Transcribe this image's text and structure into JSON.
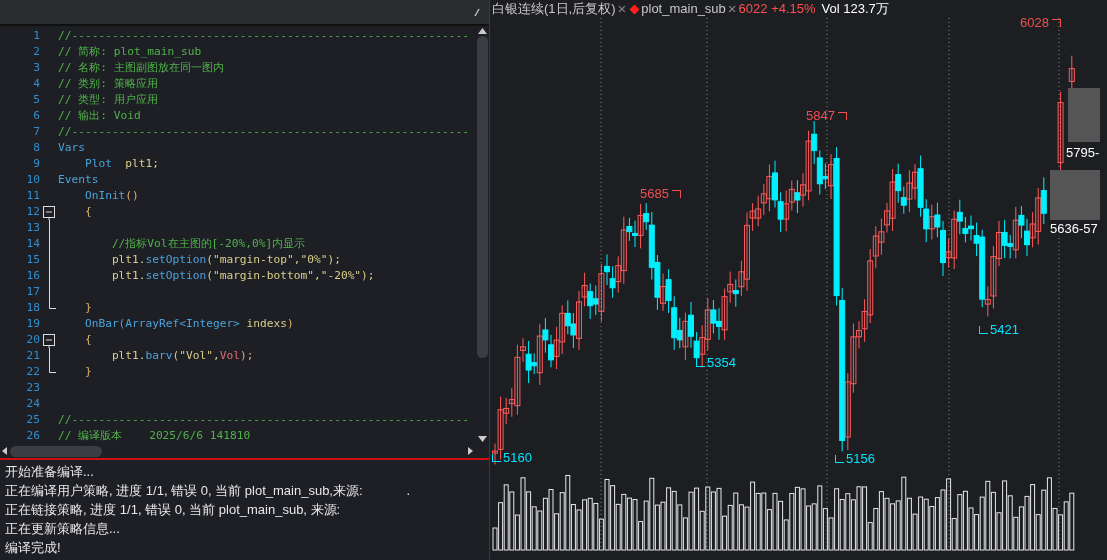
{
  "editor": {
    "lines": [
      {
        "number": "1",
        "kind": "plain",
        "tokens": [
          {
            "text": "//-----------------------------------------------------------",
            "kind": "comment"
          }
        ]
      },
      {
        "number": "2",
        "kind": "plain",
        "tokens": [
          {
            "text": "// 简称: plot_main_sub",
            "kind": "comment"
          }
        ]
      },
      {
        "number": "3",
        "kind": "plain",
        "tokens": [
          {
            "text": "// 名称: 主图副图放在同一图内",
            "kind": "comment"
          }
        ]
      },
      {
        "number": "4",
        "kind": "plain",
        "tokens": [
          {
            "text": "// 类别: 策略应用",
            "kind": "comment"
          }
        ]
      },
      {
        "number": "5",
        "kind": "plain",
        "tokens": [
          {
            "text": "// 类型: 用户应用",
            "kind": "comment"
          }
        ]
      },
      {
        "number": "6",
        "kind": "plain",
        "tokens": [
          {
            "text": "// 输出: Void",
            "kind": "comment"
          }
        ]
      },
      {
        "number": "7",
        "kind": "plain",
        "tokens": [
          {
            "text": "//-----------------------------------------------------------",
            "kind": "comment"
          }
        ]
      },
      {
        "number": "8",
        "kind": "plain",
        "tokens": [
          {
            "text": "Vars",
            "kind": "keyword"
          }
        ]
      },
      {
        "number": "9",
        "kind": "plain",
        "tokens": [
          {
            "text": "    Plot",
            "kind": "keyword"
          },
          {
            "text": "  plt1;",
            "kind": "ident"
          }
        ]
      },
      {
        "number": "10",
        "kind": "plain",
        "tokens": [
          {
            "text": "Events",
            "kind": "keyword"
          }
        ]
      },
      {
        "number": "11",
        "kind": "plain",
        "tokens": [
          {
            "text": "    OnInit",
            "kind": "keyword"
          },
          {
            "text": "()",
            "kind": "punct"
          }
        ]
      },
      {
        "number": "12",
        "kind": "fold_start",
        "tokens": [
          {
            "text": "    {",
            "kind": "punct"
          }
        ]
      },
      {
        "number": "13",
        "kind": "fold_body"
      },
      {
        "number": "14",
        "kind": "fold_body",
        "tokens": [
          {
            "text": "        //指标Vol在主图的[-20%,0%]内显示",
            "kind": "comment"
          }
        ]
      },
      {
        "number": "15",
        "kind": "fold_body",
        "tokens": [
          {
            "text": "        plt1.",
            "kind": "ident"
          },
          {
            "text": "setOption",
            "kind": "keyword"
          },
          {
            "text": "(\"margin-top\",\"0%\");",
            "kind": "string"
          }
        ]
      },
      {
        "number": "16",
        "kind": "fold_body",
        "tokens": [
          {
            "text": "        plt1.",
            "kind": "ident"
          },
          {
            "text": "setOption",
            "kind": "keyword"
          },
          {
            "text": "(\"margin-bottom\",\"-20%\");",
            "kind": "string"
          }
        ]
      },
      {
        "number": "17",
        "kind": "fold_body"
      },
      {
        "number": "18",
        "kind": "fold_end",
        "tokens": [
          {
            "text": "    }",
            "kind": "punct"
          }
        ]
      },
      {
        "number": "19",
        "kind": "plain",
        "tokens": [
          {
            "text": "    OnBar(ArrayRef<Integer>",
            "kind": "keyword"
          },
          {
            "text": " indexs",
            "kind": "ident"
          },
          {
            "text": ")",
            "kind": "punct"
          }
        ]
      },
      {
        "number": "20",
        "kind": "fold_start",
        "tokens": [
          {
            "text": "    {",
            "kind": "punct"
          }
        ]
      },
      {
        "number": "21",
        "kind": "fold_body",
        "tokens": [
          {
            "text": "        plt1.",
            "kind": "ident"
          },
          {
            "text": "barv",
            "kind": "keyword"
          },
          {
            "text": "(\"Vol\",",
            "kind": "string"
          },
          {
            "text": "Vol",
            "kind": "var"
          },
          {
            "text": ");",
            "kind": "punct"
          }
        ]
      },
      {
        "number": "22",
        "kind": "fold_end",
        "tokens": [
          {
            "text": "    }",
            "kind": "punct"
          }
        ]
      },
      {
        "number": "23",
        "kind": "plain"
      },
      {
        "number": "24",
        "kind": "plain"
      },
      {
        "number": "25",
        "kind": "plain",
        "tokens": [
          {
            "text": "//-----------------------------------------------------------",
            "kind": "comment"
          }
        ]
      },
      {
        "number": "26",
        "kind": "plain",
        "tokens": [
          {
            "text": "// 编译版本    2025/6/6 141810",
            "kind": "comment"
          }
        ]
      }
    ]
  },
  "output": {
    "lines": [
      {
        "text": "开始准备编译..."
      },
      {
        "text": "正在编译用户策略, 进度 1/1, 错误 0, 当前 plot_main_sub,来源:",
        "tail": "."
      },
      {
        "text": "正在链接策略, 进度 1/1, 错误 0, 当前 plot_main_sub, 来源:"
      },
      {
        "text": "正在更新策略信息..."
      },
      {
        "text": "编译完成!"
      }
    ]
  },
  "chart": {
    "header": [
      {
        "text": "白银连续(1日,后复权)",
        "kind": "label"
      },
      {
        "text": "×",
        "kind": "close"
      },
      {
        "text": "plot_main_sub",
        "kind": "indicator"
      },
      {
        "text": "×",
        "kind": "close"
      },
      {
        "text": "6022 +4.15%",
        "kind": "price"
      },
      {
        "text": "Vol 123.7万",
        "kind": "volume"
      }
    ],
    "price_labels": [
      {
        "text": "6028",
        "color": "#f05050"
      },
      {
        "text": "5847",
        "color": "#f05050"
      },
      {
        "text": "5685",
        "color": "#f05050"
      },
      {
        "text": "5354",
        "color": "#00e5ff"
      },
      {
        "text": "5421",
        "color": "#00e5ff"
      },
      {
        "text": "5160",
        "color": "#00e5ff"
      },
      {
        "text": "5156",
        "color": "#00e5ff"
      }
    ],
    "price_tags": [
      {
        "text": "5795-"
      },
      {
        "text": "5636-57"
      }
    ]
  }
}
